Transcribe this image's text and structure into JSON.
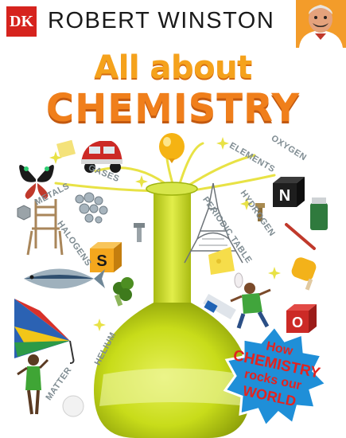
{
  "publisher": {
    "logo_text": "DK"
  },
  "author": {
    "name": "ROBERT WINSTON"
  },
  "title": {
    "line1": "All about",
    "line2": "CHEMISTRY"
  },
  "labels": {
    "gases": "GASES",
    "metals": "METALS",
    "elements": "ELEMENTS",
    "oxygen": "OXYGEN",
    "hydrogen": "HYDROGEN",
    "periodic_table": "PERIODIC TABLE",
    "halogens": "HALOGENS",
    "matter": "MATTER",
    "helium": "HELIUM"
  },
  "cube_letters": {
    "n": "N",
    "s": "S",
    "o": "O"
  },
  "badge": {
    "line1": "How",
    "line2": "CHEMISTRY",
    "line3": "rocks our",
    "line4": "WORLD"
  },
  "colors": {
    "brand_red": "#d6231e",
    "title_orange": "#f07f1b",
    "title_light_orange": "#f5a21c",
    "flask_green": "#c8dc1a",
    "badge_blue": "#1f8fd8",
    "badge_text_red": "#e3231f",
    "label_grey": "#7f8c92"
  }
}
